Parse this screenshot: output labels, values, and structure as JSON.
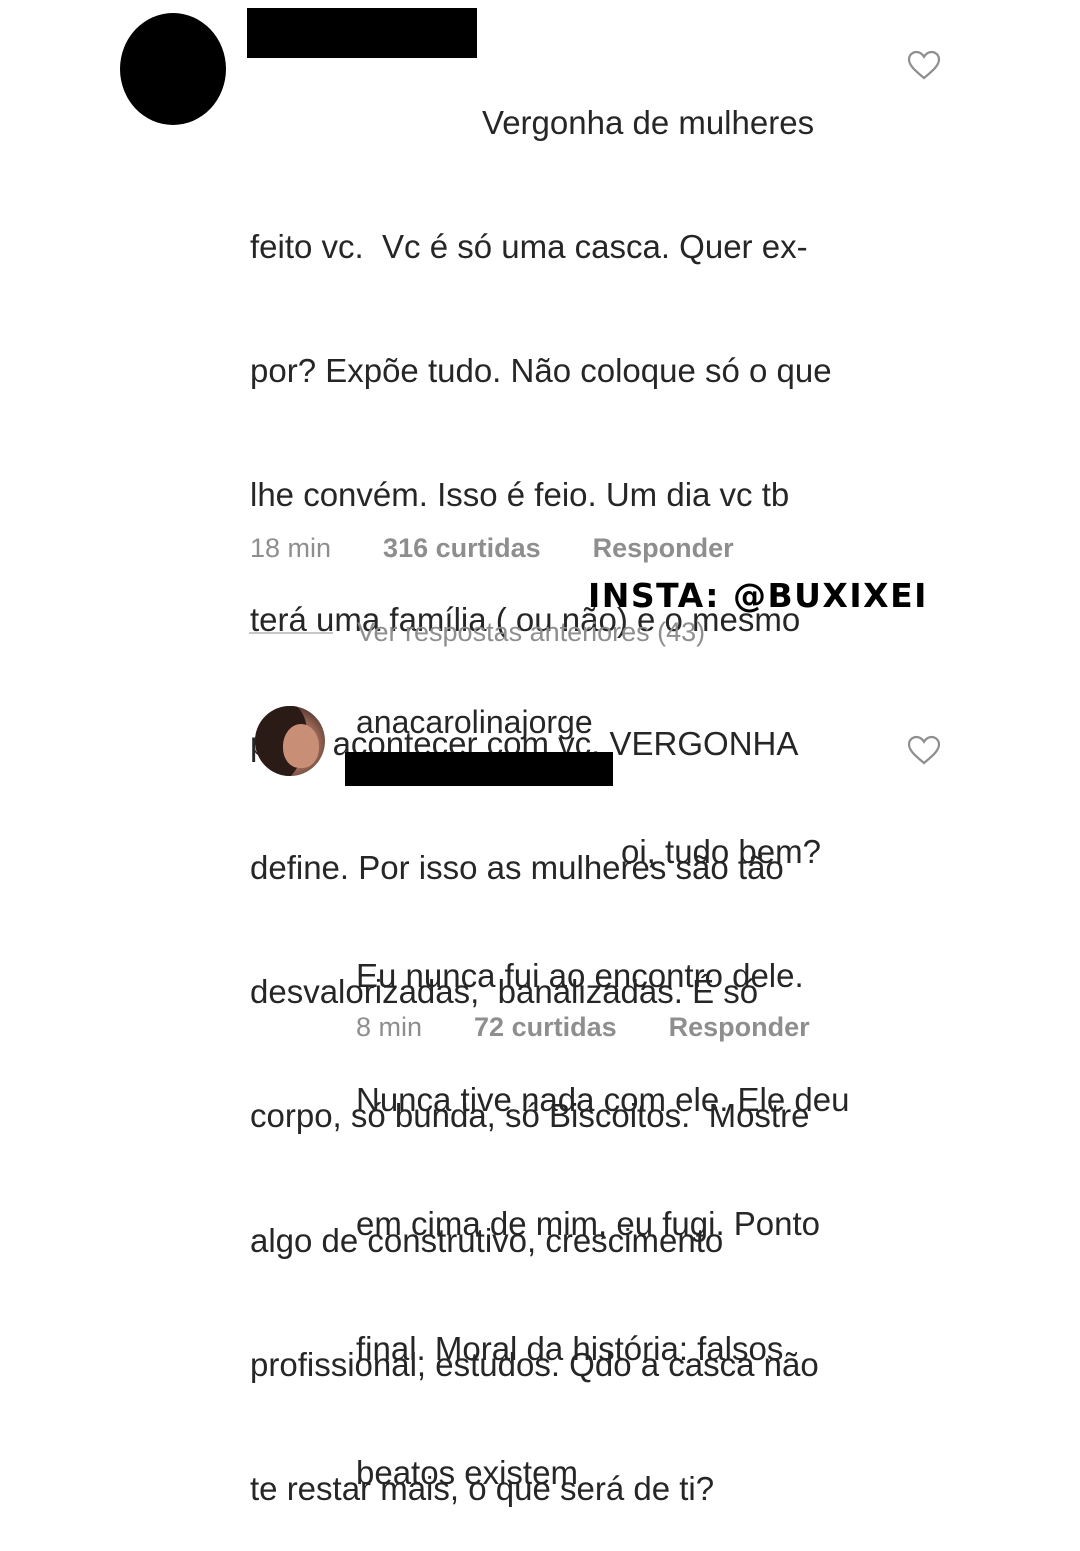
{
  "comment1": {
    "lines": [
      "Vergonha de mulheres",
      "feito vc.  Vc é só uma casca. Quer ex-",
      "por? Expõe tudo. Não coloque só o que",
      "lhe convém. Isso é feio. Um dia vc tb",
      "terá uma família ( ou não) e o mesmo",
      "pode acontecer com vc. VERGONHA",
      "define. Por isso as mulheres são tão",
      "desvalorizadas,  banalizadas. É só",
      "corpo, só bunda, só Biscoitos.  Mostre",
      "algo de construtivo, crescimento",
      "profissional, estudos. Qdo a casca não",
      "te restar mais, o que será de ti?"
    ],
    "time": "18 min",
    "likes": "316 curtidas",
    "reply": "Responder",
    "like_icon": "heart-outline-icon"
  },
  "watermark": "INSTA: @BUXIXEI",
  "view_replies": "Ver respostas anteriores (43)",
  "comment2": {
    "username": "anacarolinajorge",
    "lines": [
      "oi, tudo bem?",
      "Eu nunca fui ao encontro dele.",
      "Nunca tive nada com ele. Ele deu",
      "em cima de mim, eu fugi. Ponto",
      "final. Moral da história: falsos",
      "beatos existem"
    ],
    "time": "8 min",
    "likes": "72 curtidas",
    "reply": "Responder",
    "like_icon": "heart-outline-icon"
  },
  "colors": {
    "text": "#262626",
    "meta": "#8e8e8e",
    "divider": "#c7c7c7",
    "redaction": "#000000"
  }
}
